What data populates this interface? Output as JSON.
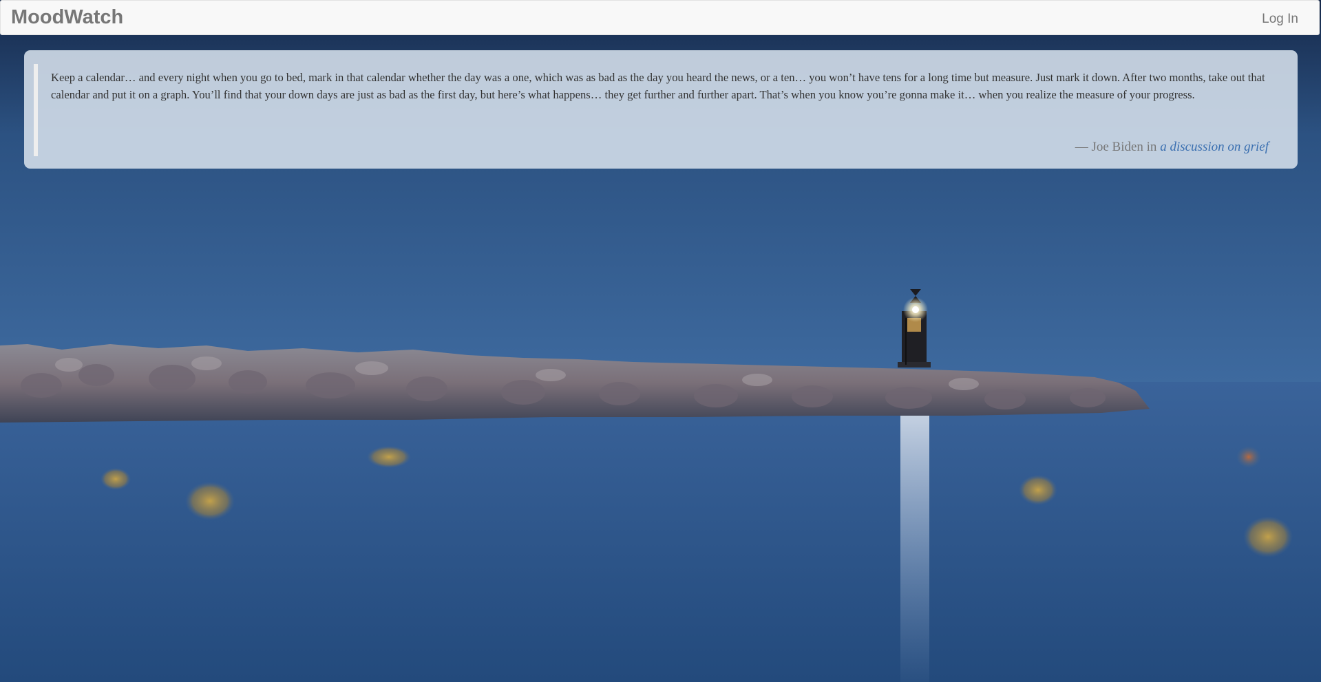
{
  "navbar": {
    "brand": "MoodWatch",
    "login_label": "Log In"
  },
  "quote": {
    "text": "Keep a calendar… and every night when you go to bed, mark in that calendar whether the day was a one, which was as bad as the day you heard the news, or a ten… you won’t have tens for a long time but measure. Just mark it down. After two months, take out that calendar and put it on a graph. You’ll find that your down days are just as bad as the first day, but here’s what happens… they get further and further apart. That’s when you know you’re gonna make it… when you realize the measure of your progress.",
    "dash": "—",
    "author": "Joe Biden",
    "in_word": "in",
    "source_link": "a discussion on grief"
  },
  "colors": {
    "navbar_bg": "#f8f8f8",
    "brand_text": "#777777",
    "quote_card_bg": "#d6e0ec",
    "link": "#3a6fb0",
    "sky": "#2e5585",
    "sea": "#2d5386"
  },
  "icons": {
    "background": "lighthouse-seascape-image"
  }
}
